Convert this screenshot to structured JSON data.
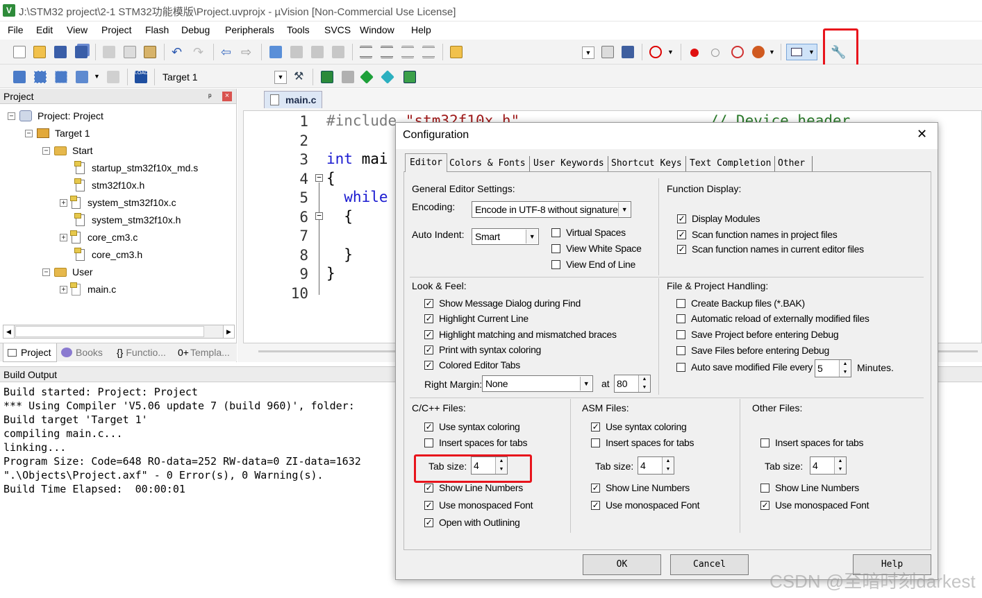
{
  "window": {
    "title": "J:\\STM32 project\\2-1 STM32功能模版\\Project.uvprojx - µVision  [Non-Commercial Use License]",
    "app_icon": "V"
  },
  "menu": [
    "File",
    "Edit",
    "View",
    "Project",
    "Flash",
    "Debug",
    "Peripherals",
    "Tools",
    "SVCS",
    "Window",
    "Help"
  ],
  "toolbar2": {
    "target_label": "Target 1"
  },
  "project_panel": {
    "title": "Project",
    "pin": "ᵖ",
    "close": "×",
    "tree": [
      {
        "label": "Project: Project",
        "expander": "−"
      },
      {
        "label": "Target 1",
        "expander": "−"
      },
      {
        "label": "Start",
        "expander": "−"
      },
      {
        "label": "startup_stm32f10x_md.s"
      },
      {
        "label": "stm32f10x.h"
      },
      {
        "label": "system_stm32f10x.c",
        "expander": "+"
      },
      {
        "label": "system_stm32f10x.h"
      },
      {
        "label": "core_cm3.c",
        "expander": "+"
      },
      {
        "label": "core_cm3.h"
      },
      {
        "label": "User",
        "expander": "−"
      },
      {
        "label": "main.c",
        "expander": "+"
      }
    ],
    "bottom_tabs": [
      "Project",
      "Books",
      "Functio...",
      "Templa..."
    ],
    "tab_glyphs": [
      "{}",
      "0+"
    ]
  },
  "editor": {
    "tab": "main.c",
    "line_numbers": [
      "1",
      "2",
      "3",
      "4",
      "5",
      "6",
      "7",
      "8",
      "9",
      "10"
    ],
    "code": [
      {
        "kw": "#include ",
        "str": "\"stm32f10x.h\"",
        "comment": "// Device header"
      },
      {
        "text": ""
      },
      {
        "kw": "int ",
        "text": "mai"
      },
      {
        "text": "{"
      },
      {
        "kw": "  while"
      },
      {
        "text": "  {"
      },
      {
        "text": ""
      },
      {
        "text": "  }"
      },
      {
        "text": "}"
      },
      {
        "text": ""
      }
    ]
  },
  "build_output": {
    "title": "Build Output",
    "lines": [
      "Build started: Project: Project",
      "*** Using Compiler 'V5.06 update 7 (build 960)', folder:",
      "Build target 'Target 1'",
      "compiling main.c...",
      "linking...",
      "Program Size: Code=648 RO-data=252 RW-data=0 ZI-data=1632",
      "\".\\Objects\\Project.axf\" - 0 Error(s), 0 Warning(s).",
      "Build Time Elapsed:  00:00:01"
    ]
  },
  "dialog": {
    "title": "Configuration",
    "close": "✕",
    "tabs": [
      "Editor",
      "Colors & Fonts",
      "User Keywords",
      "Shortcut Keys",
      "Text Completion",
      "Other"
    ],
    "general": {
      "label": "General Editor Settings:",
      "encoding_label": "Encoding:",
      "encoding_value": "Encode in UTF-8 without signature",
      "auto_indent_label": "Auto Indent:",
      "auto_indent_value": "Smart",
      "virtual_spaces": "Virtual Spaces",
      "view_white_space": "View White Space",
      "view_end_of_line": "View End of Line"
    },
    "function_display": {
      "label": "Function Display:",
      "items": [
        "Display Modules",
        "Scan function names in project files",
        "Scan function names in current editor files"
      ]
    },
    "look_feel": {
      "label": "Look & Feel:",
      "items": [
        "Show Message Dialog during Find",
        "Highlight Current Line",
        "Highlight matching and mismatched braces",
        "Print with syntax coloring",
        "Colored Editor Tabs"
      ],
      "right_margin_label": "Right Margin:",
      "right_margin_value": "None",
      "at_label": "at",
      "at_value": "80"
    },
    "file_project": {
      "label": "File & Project Handling:",
      "items": [
        "Create Backup files (*.BAK)",
        "Automatic reload of externally modified files",
        "Save Project before entering Debug",
        "Save Files before entering Debug",
        "Auto save modified File every"
      ],
      "auto_save_value": "5",
      "minutes_label": "Minutes."
    },
    "cpp_files": {
      "label": "C/C++ Files:",
      "syntax": "Use syntax coloring",
      "spaces": "Insert spaces for tabs",
      "tab_size_label": "Tab size:",
      "tab_size_value": "4",
      "line_numbers": "Show Line Numbers",
      "mono": "Use monospaced Font",
      "outlining": "Open with Outlining"
    },
    "asm_files": {
      "label": "ASM Files:",
      "syntax": "Use syntax coloring",
      "spaces": "Insert spaces for tabs",
      "tab_size_label": "Tab size:",
      "tab_size_value": "4",
      "line_numbers": "Show Line Numbers",
      "mono": "Use monospaced Font"
    },
    "other_files": {
      "label": "Other Files:",
      "spaces": "Insert spaces for tabs",
      "tab_size_label": "Tab size:",
      "tab_size_value": "4",
      "line_numbers": "Show Line Numbers",
      "mono": "Use monospaced Font"
    },
    "buttons": {
      "ok": "OK",
      "cancel": "Cancel",
      "help": "Help"
    },
    "check_glyph": "✓"
  },
  "watermark": "CSDN @至暗时刻darkest",
  "highlight_color": "#e8141c"
}
